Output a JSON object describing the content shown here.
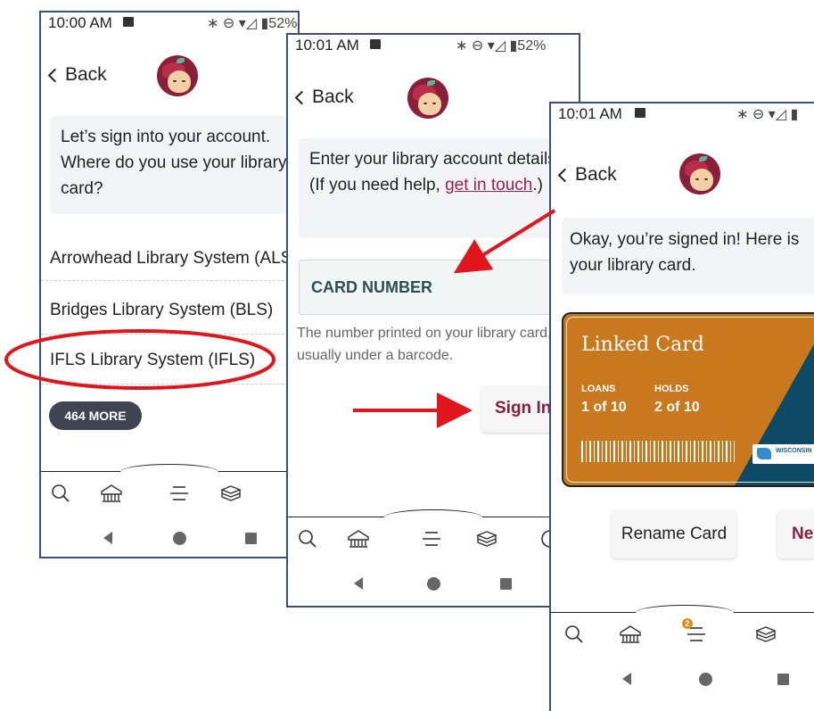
{
  "screen1": {
    "time": "10:00 AM",
    "battery": "52%",
    "back": "Back",
    "prompt": "Let’s sign into your account. Where do you use your library card?",
    "libraries": [
      "Arrowhead Library System (ALS)",
      "Bridges Library System (BLS)",
      "IFLS Library System (IFLS)"
    ],
    "more": "464 MORE"
  },
  "screen2": {
    "time": "10:01 AM",
    "battery": "52%",
    "back": "Back",
    "prompt_pre": "Enter your library account details. (If you need help, ",
    "prompt_link": "get in touch",
    "prompt_post": ".)",
    "field_label": "CARD NUMBER",
    "helper": "The number printed on your library card, usually under a barcode.",
    "signin": "Sign In"
  },
  "screen3": {
    "time": "10:01 AM",
    "back": "Back",
    "prompt": "Okay, you’re signed in! Here is your library card.",
    "card_title": "Linked Card",
    "loans_label": "LOANS",
    "loans_value": "1 of 10",
    "holds_label": "HOLDS",
    "holds_value": "2 of 10",
    "card_logo_text": "WISCONSIN",
    "rename": "Rename Card",
    "next": "Next",
    "notification_count": "2"
  },
  "colors": {
    "frame": "#3b4f7d",
    "accent": "#a61e4d",
    "annotation": "#e0161c",
    "card_orange": "#c9781e",
    "card_teal": "#0e4966"
  },
  "icons": [
    "search-icon",
    "library-icon",
    "menu-icon",
    "books-icon"
  ]
}
